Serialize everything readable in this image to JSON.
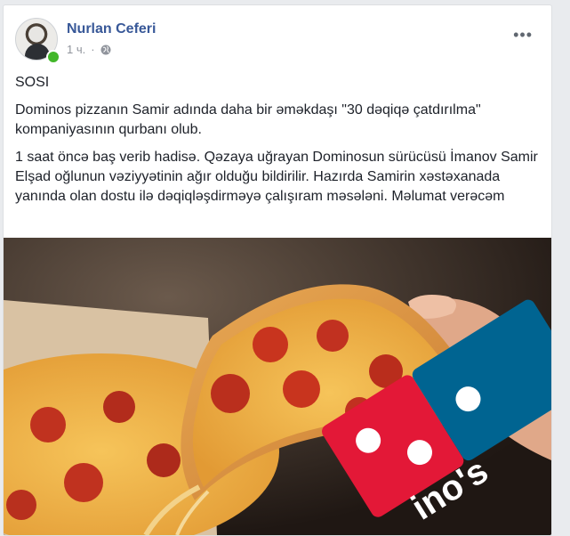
{
  "post": {
    "author": "Nurlan Ceferi",
    "time": "1 ч.",
    "separator": "·",
    "paragraphs": [
      "SOSI",
      "Dominos pizzanın Samir adında daha bir əməkdaşı \"30 dəqiqə çatdırılma\" kompaniyasının qurbanı olub.",
      "1 saat öncə baş verib hadisə. Qəzaya uğrayan Dominosun sürücüsü İmanov Samir Elşad oğlunun vəziyyətinin ağır olduğu bildirilir. Hazırda Samirin xəstəxanada yanında olan dostu ilə dəqiqləşdirməyə çalışıram məsələni. Məlumat verəcəm"
    ],
    "image_logo_text": "ino's"
  },
  "icons": {
    "more": "more-options-icon",
    "privacy": "globe-icon"
  },
  "colors": {
    "author_link": "#385898",
    "online": "#42b72a",
    "domino_red": "#e31837",
    "domino_blue": "#006491"
  }
}
